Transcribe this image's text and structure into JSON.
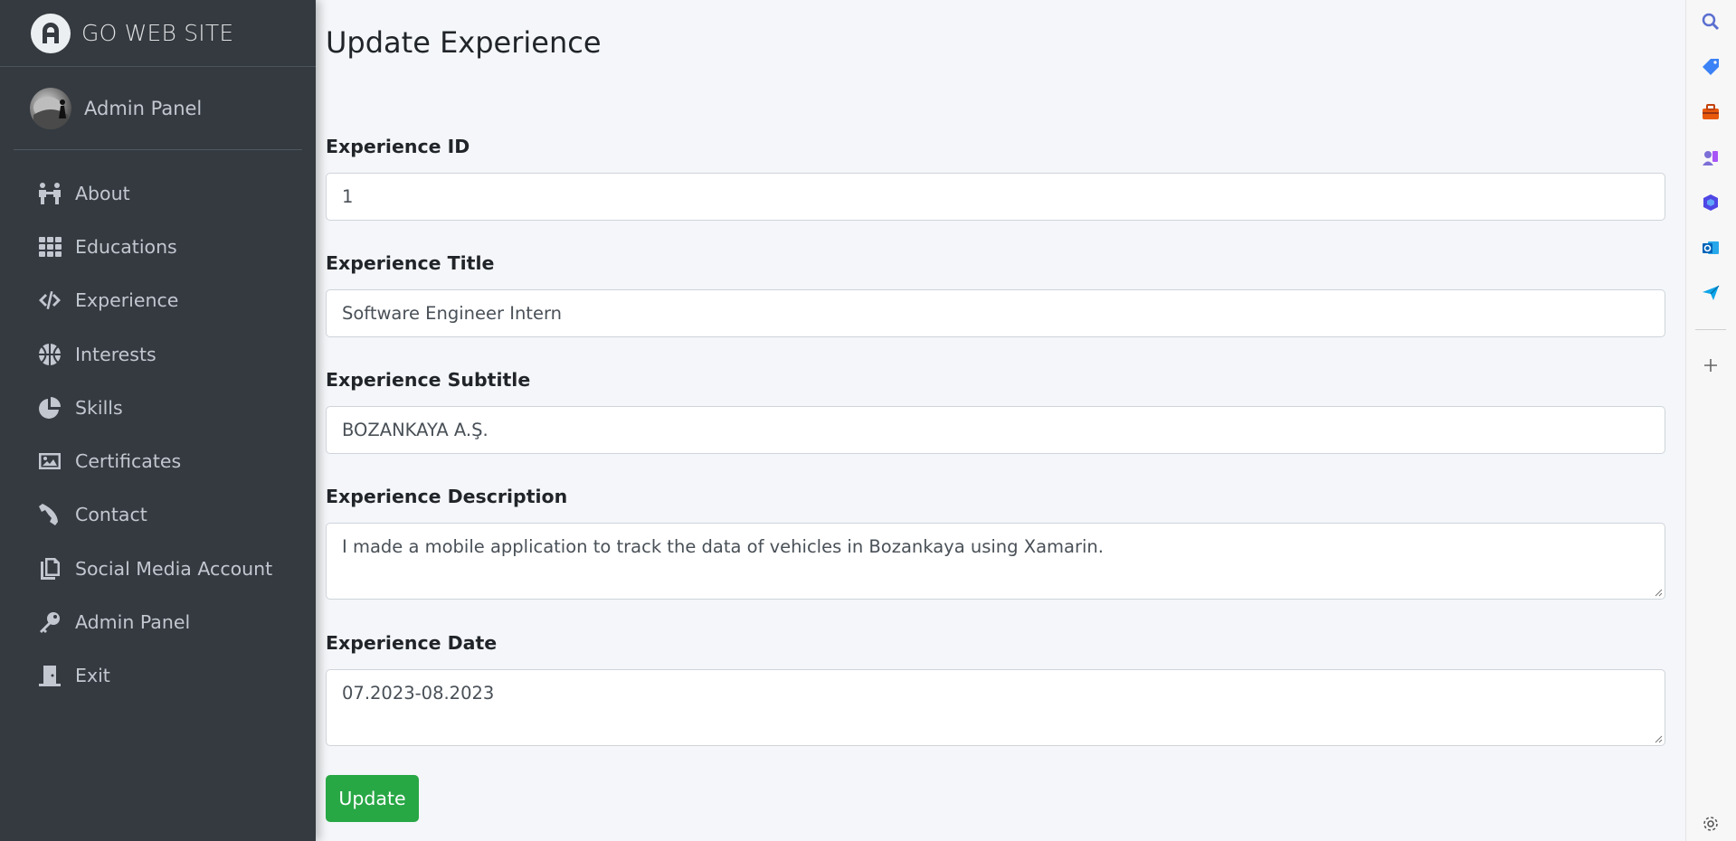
{
  "brand": {
    "title": "GO WEB SITE"
  },
  "user": {
    "name": "Admin Panel"
  },
  "sidebar": {
    "items": [
      {
        "label": "About",
        "icon": "people-icon"
      },
      {
        "label": "Educations",
        "icon": "grid-icon"
      },
      {
        "label": "Experience",
        "icon": "code-icon"
      },
      {
        "label": "Interests",
        "icon": "basketball-icon"
      },
      {
        "label": "Skills",
        "icon": "pie-chart-icon"
      },
      {
        "label": "Certificates",
        "icon": "image-icon"
      },
      {
        "label": "Contact",
        "icon": "phone-icon"
      },
      {
        "label": "Social Media Account",
        "icon": "copy-icon"
      },
      {
        "label": "Admin Panel",
        "icon": "key-icon"
      },
      {
        "label": "Exit",
        "icon": "door-icon"
      }
    ]
  },
  "form": {
    "title": "Update Experience",
    "id_label": "Experience ID",
    "id_value": "1",
    "title_label": "Experience Title",
    "title_value": "Software Engineer Intern",
    "subtitle_label": "Experience Subtitle",
    "subtitle_value": "BOZANKAYA A.Ş.",
    "description_label": "Experience Description",
    "description_value": "I made a mobile application to track the data of vehicles in Bozankaya using Xamarin.",
    "date_label": "Experience Date",
    "date_value": "07.2023-08.2023",
    "submit_label": "Update"
  },
  "edge_toolbar": {
    "icons": [
      "search-icon",
      "tag-icon",
      "toolbox-icon",
      "games-icon",
      "copilot-icon",
      "outlook-icon",
      "send-icon",
      "add-icon",
      "settings-icon"
    ]
  },
  "colors": {
    "sidebar_bg": "#343a40",
    "content_bg": "#f4f6f9",
    "button_success": "#28a745"
  }
}
